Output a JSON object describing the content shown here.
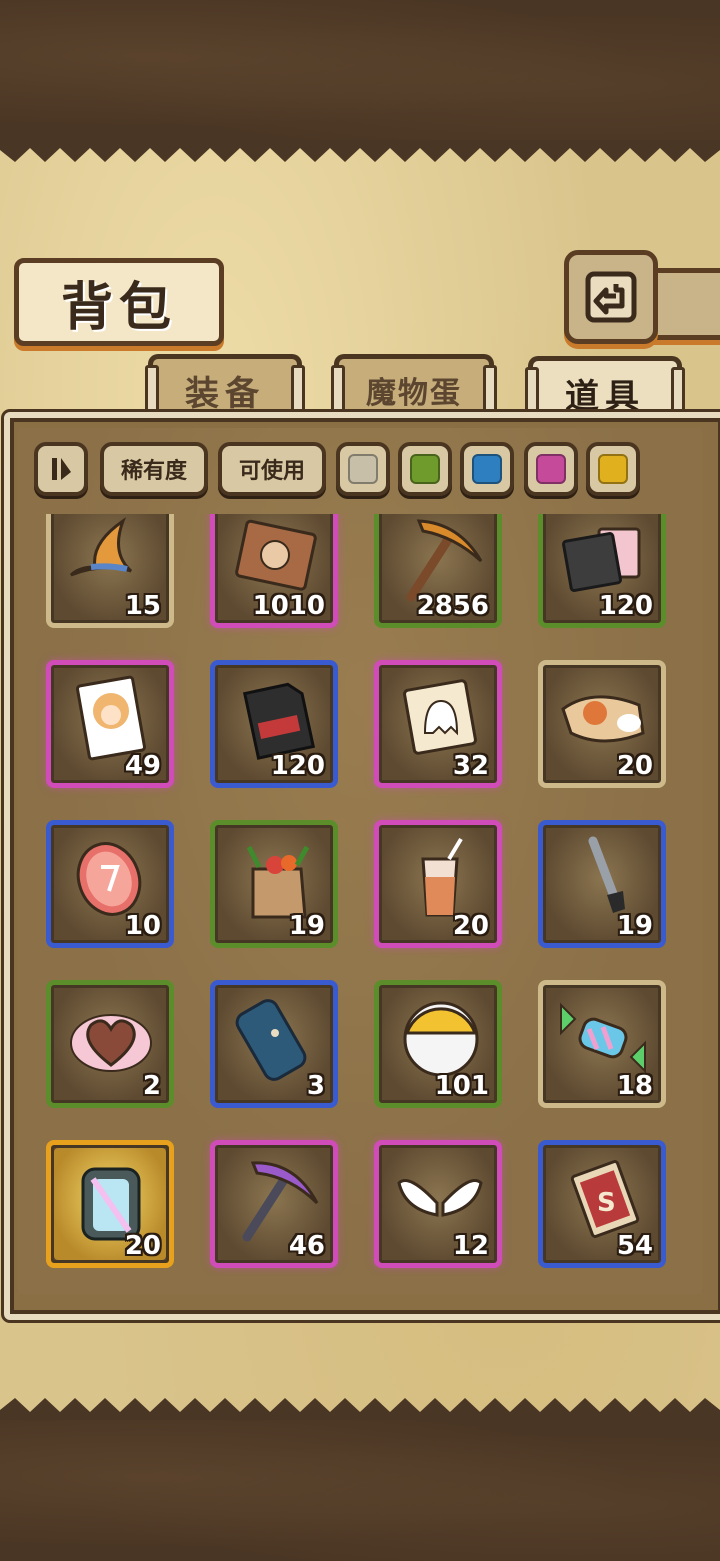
{
  "header": {
    "title": "背包"
  },
  "tabs": [
    {
      "label": "装备",
      "active": false
    },
    {
      "label": "魔物蛋",
      "active": false
    },
    {
      "label": "道具",
      "active": true
    }
  ],
  "filters": {
    "sort_label": "稀有度",
    "usable_label": "可使用",
    "rarity_colors": [
      "#c8bfa8",
      "#6f9a2c",
      "#2d7fc0",
      "#c54b9a",
      "#e0b01e"
    ]
  },
  "colors": {
    "rarity": {
      "common": "#cdb98a",
      "green": "#5b8e2a",
      "blue": "#3a5bd0",
      "pink": "#d04cb8",
      "gold": "#e8a11c"
    }
  },
  "items": [
    {
      "name": "wizard-hat",
      "count": "15",
      "rarity": "common"
    },
    {
      "name": "sealed-card",
      "count": "1010",
      "rarity": "pink"
    },
    {
      "name": "pickaxe",
      "count": "2856",
      "rarity": "green"
    },
    {
      "name": "film-pack",
      "count": "120",
      "rarity": "green"
    },
    {
      "name": "character-photo",
      "count": "49",
      "rarity": "pink"
    },
    {
      "name": "memory-card",
      "count": "120",
      "rarity": "blue"
    },
    {
      "name": "ghost-card",
      "count": "32",
      "rarity": "pink"
    },
    {
      "name": "rice-bag",
      "count": "20",
      "rarity": "common"
    },
    {
      "name": "rune-coin",
      "count": "10",
      "rarity": "blue"
    },
    {
      "name": "grocery-bag",
      "count": "19",
      "rarity": "green"
    },
    {
      "name": "iced-drink",
      "count": "20",
      "rarity": "pink"
    },
    {
      "name": "metal-rod",
      "count": "19",
      "rarity": "blue"
    },
    {
      "name": "chocolate",
      "count": "2",
      "rarity": "green"
    },
    {
      "name": "leather-roll",
      "count": "3",
      "rarity": "blue"
    },
    {
      "name": "capsule-ball",
      "count": "101",
      "rarity": "green"
    },
    {
      "name": "candy",
      "count": "18",
      "rarity": "common"
    },
    {
      "name": "crystal-backpack",
      "count": "20",
      "rarity": "gold"
    },
    {
      "name": "purple-pickaxe",
      "count": "46",
      "rarity": "pink"
    },
    {
      "name": "angel-wings",
      "count": "12",
      "rarity": "pink"
    },
    {
      "name": "s-card",
      "count": "54",
      "rarity": "blue"
    }
  ]
}
